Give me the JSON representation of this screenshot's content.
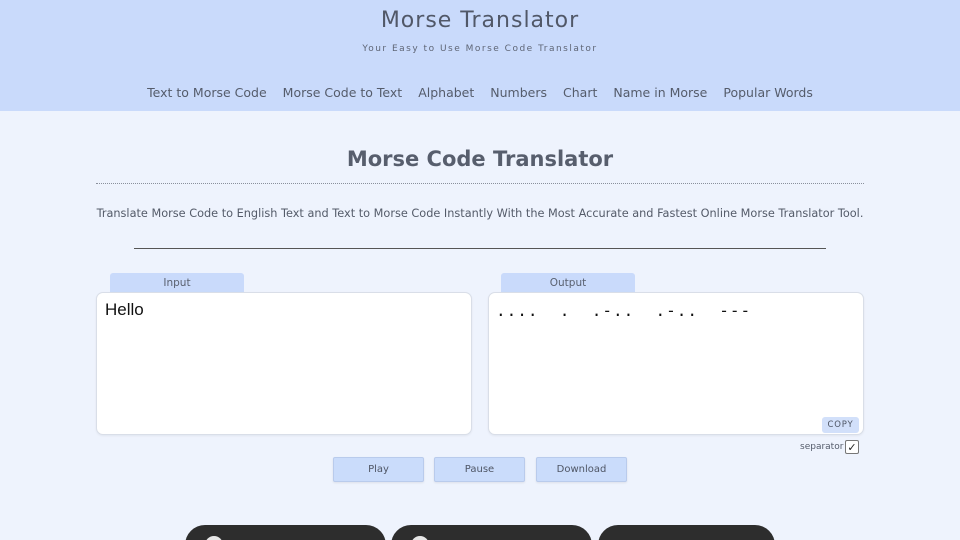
{
  "header": {
    "title": "Morse Translator",
    "tagline": "Your Easy to Use Morse Code Translator",
    "nav": [
      "Text to Morse Code",
      "Morse Code to Text",
      "Alphabet",
      "Numbers",
      "Chart",
      "Name in Morse",
      "Popular Words"
    ]
  },
  "main": {
    "title": "Morse Code Translator",
    "description": "Translate Morse Code to English Text and Text to Morse Code Instantly With the Most Accurate and Fastest Online Morse Translator Tool."
  },
  "translator": {
    "input_label": "Input",
    "input_value": "Hello",
    "output_label": "Output",
    "output_value": "....  .  .-..  .-..  ---",
    "copy_label": "COPY",
    "separator_label": "separator",
    "separator_checked": true,
    "check_glyph": "✓"
  },
  "actions": {
    "play": "Play",
    "pause": "Pause",
    "download": "Download"
  },
  "colors": {
    "header_bg": "#c9dafb",
    "page_bg": "#eef3fd",
    "button_bg": "#cadcfb",
    "badge_bg": "#2d2d2d"
  }
}
